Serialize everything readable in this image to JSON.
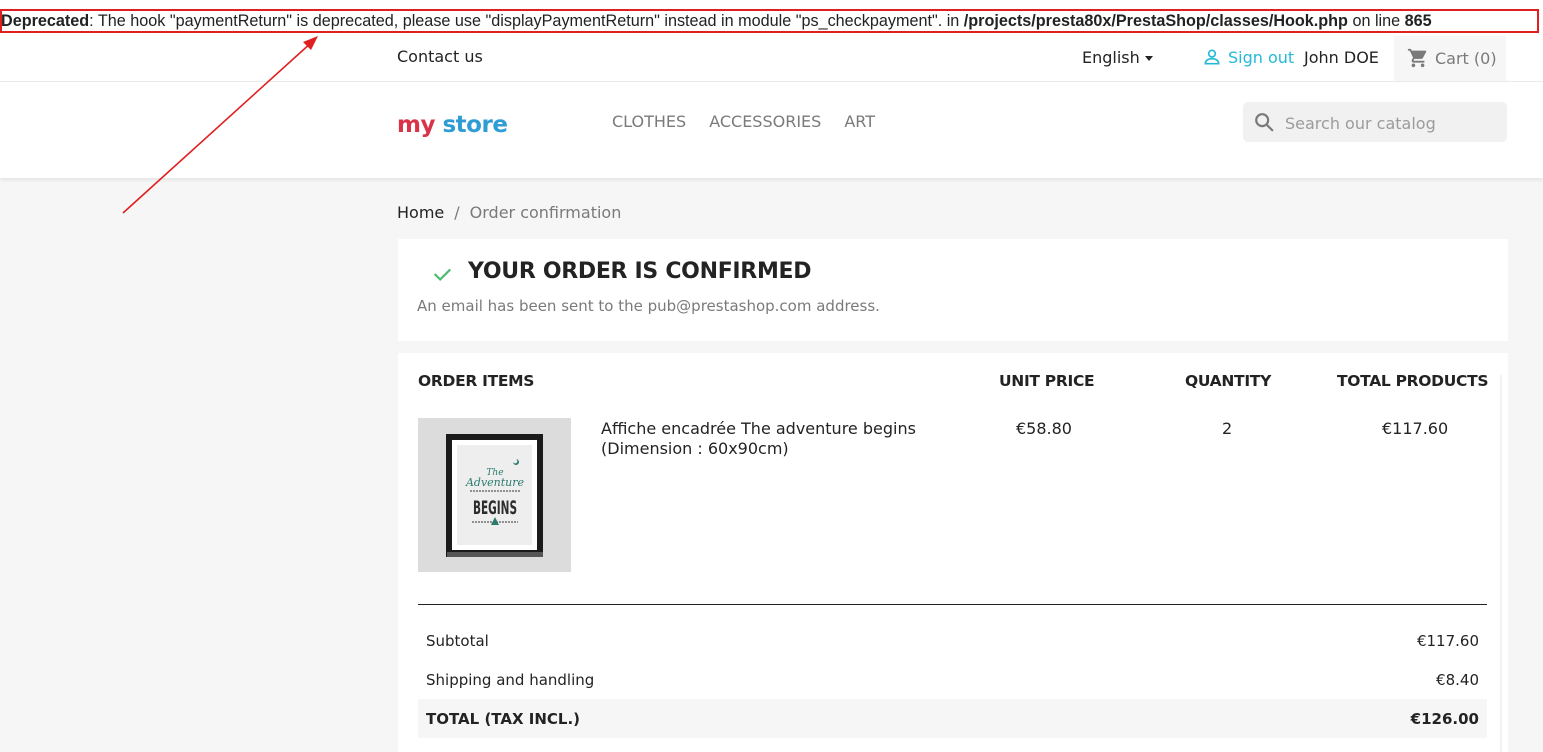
{
  "deprecated": {
    "label": "Deprecated",
    "message": ": The hook \"paymentReturn\" is deprecated, please use \"displayPaymentReturn\" instead in module \"ps_checkpayment\". in ",
    "file": "/projects/presta80x/PrestaShop/classes/Hook.php",
    "line_text": " on line ",
    "line_number": "865"
  },
  "header": {
    "contact": "Contact us",
    "language": "English",
    "signout": "Sign out",
    "user": "John DOE",
    "cart": "Cart (0)",
    "logo": {
      "word1": "my",
      "word2": "store"
    },
    "menu": [
      "CLOTHES",
      "ACCESSORIES",
      "ART"
    ],
    "search_placeholder": "Search our catalog"
  },
  "breadcrumb": {
    "home": "Home",
    "separator": "/",
    "current": "Order confirmation"
  },
  "confirmation": {
    "title": "YOUR ORDER IS CONFIRMED",
    "message": "An email has been sent to the pub@prestashop.com address."
  },
  "order": {
    "columns": {
      "items": "ORDER ITEMS",
      "unit_price": "UNIT PRICE",
      "quantity": "QUANTITY",
      "total_products": "TOTAL PRODUCTS"
    },
    "product": {
      "name": "Affiche encadrée The adventure begins (Dimension : 60x90cm)",
      "unit_price": "€58.80",
      "quantity": "2",
      "total": "€117.60",
      "image_text": {
        "line1": "The",
        "line2": "Adventure",
        "line3": "BEGINS"
      }
    },
    "totals": {
      "subtotal_label": "Subtotal",
      "subtotal_value": "€117.60",
      "shipping_label": "Shipping and handling",
      "shipping_value": "€8.40",
      "total_label": "TOTAL (TAX INCL.)",
      "total_value": "€126.00"
    }
  },
  "colors": {
    "accent": "#24b9d7",
    "success": "#4cbb6c",
    "annotation": "#e02020"
  }
}
